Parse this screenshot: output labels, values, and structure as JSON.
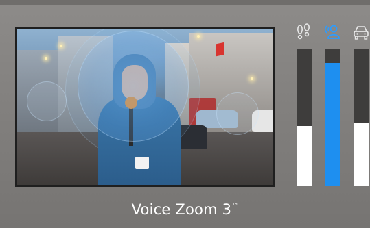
{
  "caption": {
    "title": "Voice Zoom 3",
    "trademark": "™"
  },
  "meters": [
    {
      "name": "footsteps",
      "icon": "footsteps-icon",
      "level": 0.44,
      "color": "#ffffff",
      "icon_color": "#e8e8e8"
    },
    {
      "name": "voice",
      "icon": "voice-person-icon",
      "level": 0.9,
      "color": "#1e8ff0",
      "icon_color": "#2b9cff"
    },
    {
      "name": "car",
      "icon": "car-icon",
      "level": 0.46,
      "color": "#ffffff",
      "icon_color": "#e8e8e8"
    }
  ],
  "colors": {
    "accent": "#1e8ff0",
    "track": "#3e3d3c",
    "background": "#858381"
  }
}
